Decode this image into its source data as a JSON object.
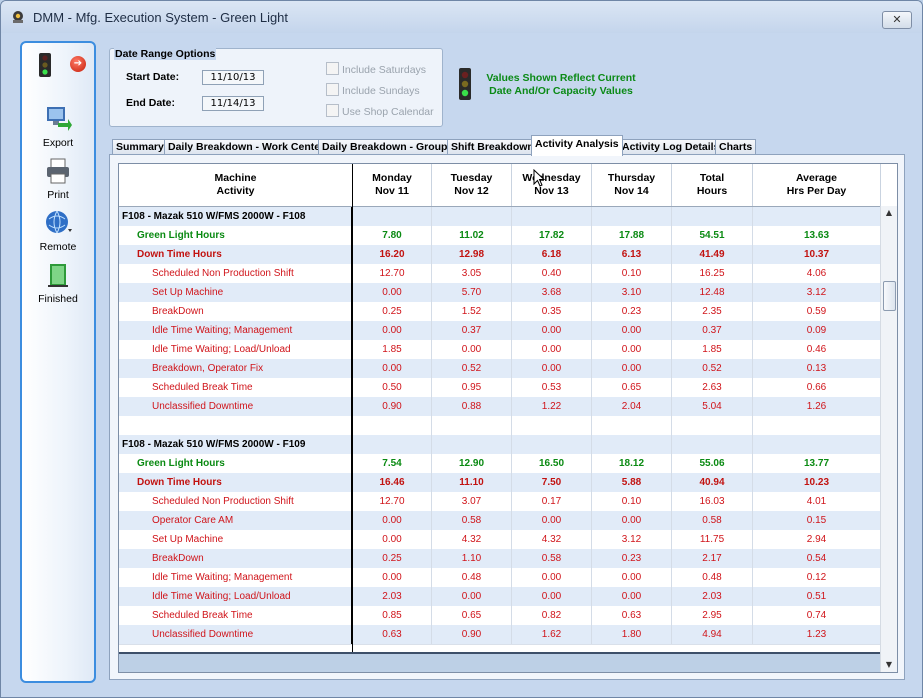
{
  "window": {
    "title": "DMM - Mfg. Execution System - Green Light",
    "close_label": "✕"
  },
  "nav": {
    "items": [
      {
        "label": "Export",
        "icon": "export-icon"
      },
      {
        "label": "Print",
        "icon": "printer-icon"
      },
      {
        "label": "Remote",
        "icon": "globe-icon"
      },
      {
        "label": "Finished",
        "icon": "finished-icon"
      }
    ]
  },
  "date_range": {
    "title": "Date Range Options",
    "start_label": "Start Date:",
    "start_value": "11/10/13",
    "end_label": "End Date:",
    "end_value": "11/14/13",
    "include_saturdays": "Include Saturdays",
    "include_sundays": "Include Sundays",
    "use_shop_calendar": "Use Shop Calendar"
  },
  "notice": {
    "line1": "Values Shown Reflect Current",
    "line2": "Date And/Or Capacity Values"
  },
  "tabs": [
    "Summary",
    "Daily Breakdown - Work Center",
    "Daily Breakdown - Groups",
    "Shift Breakdown",
    "Activity Analysis",
    "Activity Log Details",
    "Charts"
  ],
  "active_tab": "Activity Analysis",
  "grid": {
    "headers": [
      {
        "line1": "Machine",
        "line2": "Activity"
      },
      {
        "line1": "Monday",
        "line2": "Nov 11"
      },
      {
        "line1": "Tuesday",
        "line2": "Nov 12"
      },
      {
        "line1": "Wednesday",
        "line2": "Nov 13"
      },
      {
        "line1": "Thursday",
        "line2": "Nov 14"
      },
      {
        "line1": "Total",
        "line2": "Hours"
      },
      {
        "line1": "Average",
        "line2": "Hrs Per Day"
      }
    ],
    "rows": [
      {
        "type": "group",
        "label": "F108 - Mazak 510 W/FMS 2000W - F108",
        "values": [
          "",
          "",
          "",
          "",
          "",
          ""
        ]
      },
      {
        "type": "green",
        "label": "Green Light Hours",
        "values": [
          "7.80",
          "11.02",
          "17.82",
          "17.88",
          "54.51",
          "13.63"
        ]
      },
      {
        "type": "down",
        "label": "Down Time Hours",
        "values": [
          "16.20",
          "12.98",
          "6.18",
          "6.13",
          "41.49",
          "10.37"
        ]
      },
      {
        "type": "detail",
        "label": "Scheduled Non Production Shift",
        "values": [
          "12.70",
          "3.05",
          "0.40",
          "0.10",
          "16.25",
          "4.06"
        ]
      },
      {
        "type": "detail",
        "label": "Set Up Machine",
        "values": [
          "0.00",
          "5.70",
          "3.68",
          "3.10",
          "12.48",
          "3.12"
        ]
      },
      {
        "type": "detail",
        "label": "BreakDown",
        "values": [
          "0.25",
          "1.52",
          "0.35",
          "0.23",
          "2.35",
          "0.59"
        ]
      },
      {
        "type": "detail",
        "label": "Idle Time Waiting;  Management",
        "values": [
          "0.00",
          "0.37",
          "0.00",
          "0.00",
          "0.37",
          "0.09"
        ]
      },
      {
        "type": "detail",
        "label": "Idle Time Waiting;  Load/Unload",
        "values": [
          "1.85",
          "0.00",
          "0.00",
          "0.00",
          "1.85",
          "0.46"
        ]
      },
      {
        "type": "detail",
        "label": "Breakdown, Operator Fix",
        "values": [
          "0.00",
          "0.52",
          "0.00",
          "0.00",
          "0.52",
          "0.13"
        ]
      },
      {
        "type": "detail",
        "label": "Scheduled Break Time",
        "values": [
          "0.50",
          "0.95",
          "0.53",
          "0.65",
          "2.63",
          "0.66"
        ]
      },
      {
        "type": "detail",
        "label": "Unclassified  Downtime",
        "values": [
          "0.90",
          "0.88",
          "1.22",
          "2.04",
          "5.04",
          "1.26"
        ]
      },
      {
        "type": "blank",
        "label": "",
        "values": [
          "",
          "",
          "",
          "",
          "",
          ""
        ]
      },
      {
        "type": "group",
        "label": "F108 - Mazak 510 W/FMS 2000W - F109",
        "values": [
          "",
          "",
          "",
          "",
          "",
          ""
        ]
      },
      {
        "type": "green",
        "label": "Green Light Hours",
        "values": [
          "7.54",
          "12.90",
          "16.50",
          "18.12",
          "55.06",
          "13.77"
        ]
      },
      {
        "type": "down",
        "label": "Down Time Hours",
        "values": [
          "16.46",
          "11.10",
          "7.50",
          "5.88",
          "40.94",
          "10.23"
        ]
      },
      {
        "type": "detail",
        "label": "Scheduled Non Production Shift",
        "values": [
          "12.70",
          "3.07",
          "0.17",
          "0.10",
          "16.03",
          "4.01"
        ]
      },
      {
        "type": "detail",
        "label": "Operator Care AM",
        "values": [
          "0.00",
          "0.58",
          "0.00",
          "0.00",
          "0.58",
          "0.15"
        ]
      },
      {
        "type": "detail",
        "label": "Set Up Machine",
        "values": [
          "0.00",
          "4.32",
          "4.32",
          "3.12",
          "11.75",
          "2.94"
        ]
      },
      {
        "type": "detail",
        "label": "BreakDown",
        "values": [
          "0.25",
          "1.10",
          "0.58",
          "0.23",
          "2.17",
          "0.54"
        ]
      },
      {
        "type": "detail",
        "label": "Idle Time Waiting;  Management",
        "values": [
          "0.00",
          "0.48",
          "0.00",
          "0.00",
          "0.48",
          "0.12"
        ]
      },
      {
        "type": "detail",
        "label": "Idle Time Waiting;  Load/Unload",
        "values": [
          "2.03",
          "0.00",
          "0.00",
          "0.00",
          "2.03",
          "0.51"
        ]
      },
      {
        "type": "detail",
        "label": "Scheduled Break Time",
        "values": [
          "0.85",
          "0.65",
          "0.82",
          "0.63",
          "2.95",
          "0.74"
        ]
      },
      {
        "type": "detail",
        "label": "Unclassified  Downtime",
        "values": [
          "0.63",
          "0.90",
          "1.62",
          "1.80",
          "4.94",
          "1.23"
        ]
      }
    ]
  },
  "colors": {
    "green": "#0a8a12",
    "red": "#c21210",
    "row_blue": "#e1ebf8",
    "accent": "#3c8ddf"
  }
}
